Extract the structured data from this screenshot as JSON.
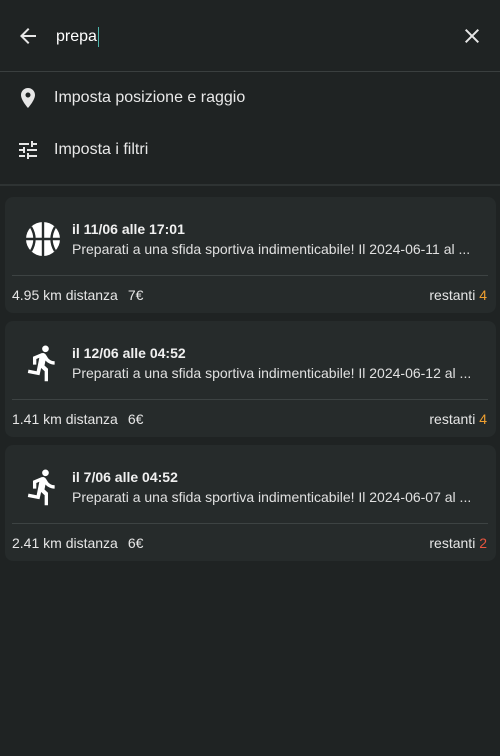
{
  "search": {
    "query": "prepa"
  },
  "options": {
    "location_label": "Imposta posizione e raggio",
    "filters_label": "Imposta i filtri"
  },
  "events": [
    {
      "icon": "basketball-icon",
      "date": "il 11/06 alle 17:01",
      "description": "Preparati a una sfida sportiva indimenticabile! Il 2024-06-11 al ...",
      "distance": "4.95 km distanza",
      "price": "7€",
      "remaining_label": "restanti",
      "remaining_count": "4",
      "count_color": "#f0a030"
    },
    {
      "icon": "running-icon",
      "date": "il 12/06 alle 04:52",
      "description": "Preparati a una sfida sportiva indimenticabile! Il 2024-06-12 al ...",
      "distance": "1.41 km distanza",
      "price": "6€",
      "remaining_label": "restanti",
      "remaining_count": "4",
      "count_color": "#f0a030"
    },
    {
      "icon": "running-icon",
      "date": "il 7/06 alle 04:52",
      "description": "Preparati a una sfida sportiva indimenticabile! Il 2024-06-07 al ...",
      "distance": "2.41 km distanza",
      "price": "6€",
      "remaining_label": "restanti",
      "remaining_count": "2",
      "count_color": "#e8553e"
    }
  ]
}
